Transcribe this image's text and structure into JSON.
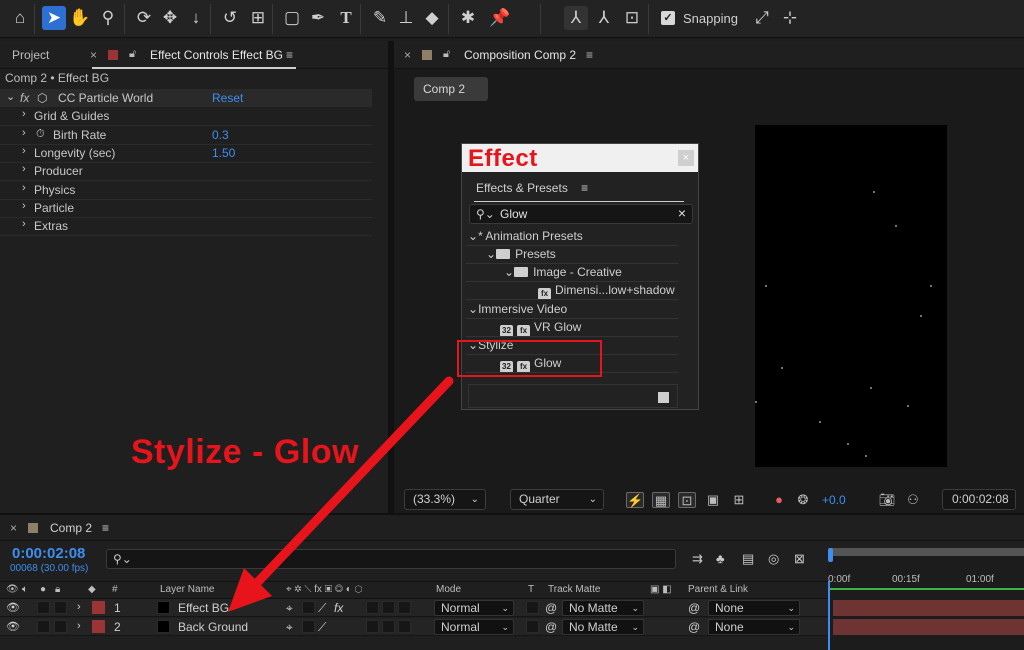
{
  "toolbar": {
    "tools": [
      "home-icon",
      "select-tool-icon",
      "hand-tool-icon",
      "zoom-tool-icon",
      "orbit-camera-icon",
      "pan-camera-icon",
      "dolly-camera-icon",
      "rotate-tool-icon",
      "pan-behind-icon",
      "rectangle-tool-icon",
      "pen-tool-icon",
      "type-tool-icon",
      "brush-tool-icon",
      "clone-stamp-icon",
      "eraser-tool-icon",
      "roto-brush-icon",
      "puppet-pin-icon",
      "axis-local-icon",
      "axis-world-icon",
      "axis-view-icon"
    ],
    "snapping_label": "Snapping"
  },
  "left_panel": {
    "tab_project": "Project",
    "tab_effect_controls": "Effect Controls Effect BG",
    "breadcrumb": "Comp 2 • Effect BG",
    "effect_name": "CC Particle World",
    "reset_label": "Reset",
    "properties": [
      {
        "label": "Grid & Guides",
        "value": ""
      },
      {
        "label": "Birth Rate",
        "value": "0.3"
      },
      {
        "label": "Longevity (sec)",
        "value": "1.50"
      },
      {
        "label": "Producer",
        "value": ""
      },
      {
        "label": "Physics",
        "value": ""
      },
      {
        "label": "Particle",
        "value": ""
      },
      {
        "label": "Extras",
        "value": ""
      }
    ]
  },
  "comp_panel": {
    "tab_label": "Composition Comp 2",
    "comp_button": "Comp 2",
    "zoom": "(33.3%)",
    "resolution": "Quarter",
    "exposure": "+0.0",
    "timecode": "0:00:02:08"
  },
  "effects_presets": {
    "overlay_title": "Effect",
    "tab_label": "Effects & Presets",
    "search_value": "Glow",
    "tree": [
      {
        "label": "* Animation Presets"
      },
      {
        "label": "Presets"
      },
      {
        "label": "Image - Creative"
      },
      {
        "label": "Dimensi...low+shadow"
      },
      {
        "label": "Immersive Video"
      },
      {
        "label": "VR Glow"
      },
      {
        "label": "Stylize"
      },
      {
        "label": "Glow"
      }
    ],
    "bit_badge": "32"
  },
  "annotation": {
    "text": "Stylize - Glow",
    "color": "#e8141c"
  },
  "timeline": {
    "tab_label": "Comp 2",
    "current_time": "0:00:02:08",
    "frames": "00068 (30.00 fps)",
    "headers": {
      "number": "#",
      "layer_name": "Layer Name",
      "mode": "Mode",
      "t": "T",
      "track_matte": "Track Matte",
      "parent": "Parent & Link"
    },
    "ruler": [
      "0:00f",
      "00:15f",
      "01:00f"
    ],
    "layers": [
      {
        "num": "1",
        "name": "Effect BG",
        "mode": "Normal",
        "matte": "No Matte",
        "parent": "None"
      },
      {
        "num": "2",
        "name": "Back Ground",
        "mode": "Normal",
        "matte": "No Matte",
        "parent": "None"
      }
    ]
  },
  "colors": {
    "accent_blue": "#2d6fd3",
    "value_blue": "#3d8ef0",
    "label_red": "#9b3434"
  }
}
